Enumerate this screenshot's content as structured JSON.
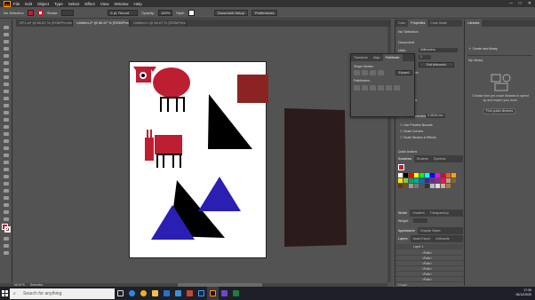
{
  "menu": {
    "app_logo": "Ai",
    "items": [
      "File",
      "Edit",
      "Object",
      "Type",
      "Select",
      "Effect",
      "View",
      "Window",
      "Help"
    ]
  },
  "control_bar": {
    "selection_label": "No Selection",
    "stroke_label": "Stroke:",
    "stroke_width": "",
    "brush_label": "5 pt. Round",
    "opacity_label": "Opacity:",
    "opacity_value": "100%",
    "style_label": "Style:",
    "doc_setup": "Document Setup",
    "preferences": "Preferences"
  },
  "tabs": [
    {
      "label": "DF1.ai* @ 66.61 % (RGB/Preview)"
    },
    {
      "label": "Untitled-2* @ 66.67 % (RGB/Preview)"
    },
    {
      "label": "Untitled-1 @ 66.67 % (RGB/Preview)"
    }
  ],
  "status": {
    "zoom": "66.67%",
    "tool": "Selection"
  },
  "properties": {
    "tabs": [
      "Color",
      "Properties",
      "Color Guide"
    ],
    "no_selection": "No Selection",
    "document": "Document",
    "units_label": "Units:",
    "units_value": "Millimeters",
    "artboard_label": "Artboard:",
    "artboard_value": "1",
    "edit_artboards": "Edit Artboards",
    "rulers_grids": "Rulers & Grids",
    "guides": "Guides",
    "snap_options": "Snap Options",
    "preferences_title": "Preferences",
    "keyboard_increment": "Keyboard Increment:",
    "keyboard_value": "0.3528 mm",
    "use_preview_bounds": "Use Preview Bounds",
    "round_corners": "Scale Corners",
    "scale_strokes": "Scale Strokes & Effects",
    "quick_actions": "Quick Actions",
    "swatches_tabs": [
      "Swatches",
      "Brushes",
      "Symbols"
    ],
    "stroke_tabs": [
      "Stroke",
      "Gradient",
      "Transparency"
    ],
    "weight_label": "Weight:",
    "appearance_tabs": [
      "Appearance",
      "Graphic Styles"
    ],
    "layers_tabs": [
      "Layers",
      "Asset Export",
      "Artboards"
    ],
    "layer_name": "Layer 1",
    "sublayers": [
      "<Path>",
      "<Path>",
      "<Path>",
      "<Path>",
      "<Path>",
      "<Path>"
    ],
    "layers_count": "1 Layer"
  },
  "popup": {
    "tabs": [
      "Transform",
      "Align",
      "Pathfinder"
    ],
    "shape_modes": "Shape Modes:",
    "expand": "Expand",
    "pathfinders": "Pathfinders:"
  },
  "libraries": {
    "title": "Libraries",
    "create": "Create new library",
    "my_library": "My Library",
    "desc": "Choose from pre-made libraries to speed up and inspire your work.",
    "find_button": "Find public libraries"
  },
  "taskbar": {
    "search_placeholder": "Search for anything",
    "time": "17:30",
    "date": "06/12/2020"
  },
  "colors": {
    "accent_red": "#be1e32",
    "dark_red": "#8b2323",
    "dark_rect": "#2b1b1b",
    "blue": "#2b1fb3",
    "black": "#000000"
  }
}
